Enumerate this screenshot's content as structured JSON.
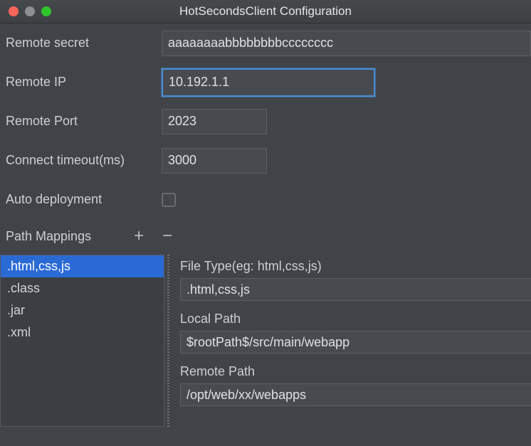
{
  "titlebar": {
    "title": "HotSecondsClient Configuration",
    "buttons": {
      "close": "close-button",
      "minimize": "minimize-button",
      "zoom": "zoom-button"
    }
  },
  "form": {
    "fields": [
      {
        "label": "Remote secret",
        "value": "aaaaaaaabbbbbbbbcccccccc",
        "placeholder": ""
      },
      {
        "label": "Remote IP",
        "value": "10.192.1.1",
        "placeholder": "",
        "focused": true
      },
      {
        "label": "Remote Port",
        "value": "2023",
        "placeholder": ""
      },
      {
        "label": "Connect timeout(ms)",
        "value": "3000",
        "placeholder": ""
      }
    ],
    "auto_deployment": {
      "label": "Auto deployment",
      "checked": false
    }
  },
  "path_mappings": {
    "label": "Path Mappings",
    "add_label": "+",
    "remove_label": "−",
    "list": [
      ".html,css,js",
      ".class",
      ".jar",
      ".xml"
    ],
    "selected_index": 0,
    "detail": {
      "file_type_label": "File Type(eg: html,css,js)",
      "file_type_value": ".html,css,js",
      "local_path_label": "Local Path",
      "local_path_value": "$rootPath$/src/main/webapp",
      "remote_path_label": "Remote Path",
      "remote_path_value": "/opt/web/xx/webapps"
    }
  },
  "colors": {
    "window_bg": "#404448",
    "titlebar_bg": "#43464a",
    "accent_selection": "#2a6ad4",
    "focus_border": "#4b8ed8",
    "field_bg": "#474b4f",
    "text": "#cdd0d2",
    "close": "#f9655b",
    "minimize": "#8d9093",
    "zoom": "#2fc52f"
  }
}
